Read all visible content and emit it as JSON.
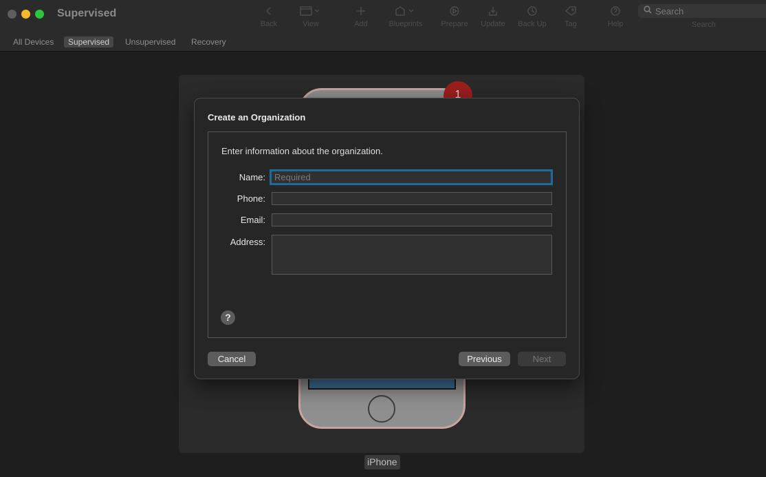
{
  "window": {
    "title": "Supervised"
  },
  "toolbar": {
    "items": [
      {
        "label": "Back",
        "icon": "chevron-left-icon"
      },
      {
        "label": "View",
        "icon": "window-view-icon"
      },
      {
        "label": "Add",
        "icon": "plus-icon"
      },
      {
        "label": "Blueprints",
        "icon": "blueprints-icon"
      },
      {
        "label": "Prepare",
        "icon": "prepare-icon"
      },
      {
        "label": "Update",
        "icon": "download-icon"
      },
      {
        "label": "Back Up",
        "icon": "backup-icon"
      },
      {
        "label": "Tag",
        "icon": "tag-icon"
      },
      {
        "label": "Help",
        "icon": "help-circle-icon"
      }
    ],
    "search": {
      "placeholder": "Search",
      "label": "Search"
    }
  },
  "tabs": [
    {
      "label": "All Devices",
      "active": false
    },
    {
      "label": "Supervised",
      "active": true
    },
    {
      "label": "Unsupervised",
      "active": false
    },
    {
      "label": "Recovery",
      "active": false
    }
  ],
  "device": {
    "name": "iPhone",
    "badge_count": "1"
  },
  "dialog": {
    "title": "Create an Organization",
    "intro": "Enter information about the organization.",
    "fields": {
      "name": {
        "label": "Name:",
        "placeholder": "Required",
        "value": ""
      },
      "phone": {
        "label": "Phone:",
        "value": ""
      },
      "email": {
        "label": "Email:",
        "value": ""
      },
      "address": {
        "label": "Address:",
        "value": ""
      }
    },
    "help_symbol": "?",
    "buttons": {
      "cancel": "Cancel",
      "previous": "Previous",
      "next": "Next"
    }
  },
  "colors": {
    "focus_ring": "#1f6a9c",
    "badge": "#9c1e1e",
    "traffic_yellow": "#f5b92d",
    "traffic_green": "#2fc440"
  }
}
